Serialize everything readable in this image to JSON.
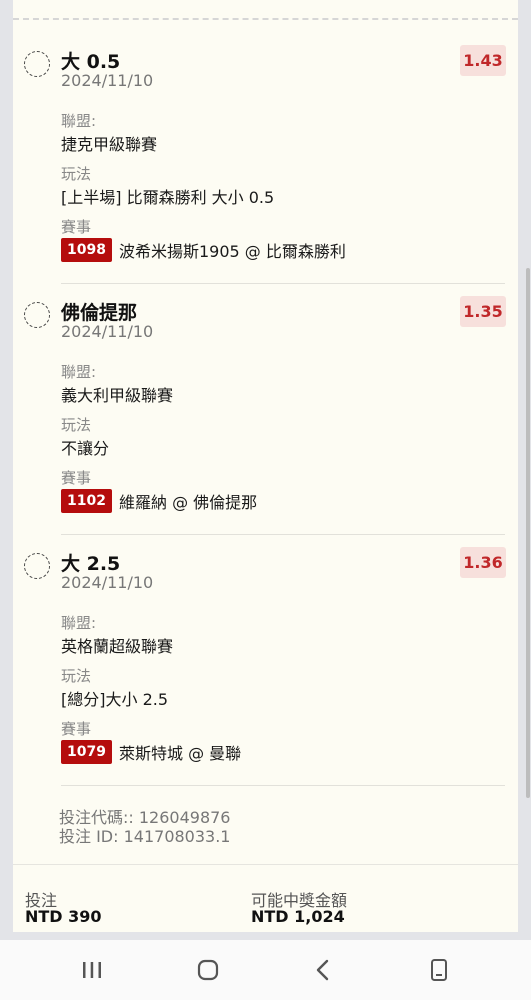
{
  "bets": [
    {
      "title": "大 0.5",
      "date": "2024/11/10",
      "odds": "1.43",
      "league_label": "聯盟:",
      "league": "捷克甲級聯賽",
      "market_label": "玩法",
      "market": "[上半場] 比爾森勝利 大小 0.5",
      "match_label": "賽事",
      "match_id": "1098",
      "match": "波希米揚斯1905 @ 比爾森勝利"
    },
    {
      "title": "佛倫提那",
      "date": "2024/11/10",
      "odds": "1.35",
      "league_label": "聯盟:",
      "league": "義大利甲級聯賽",
      "market_label": "玩法",
      "market": "不讓分",
      "match_label": "賽事",
      "match_id": "1102",
      "match": "維羅納 @ 佛倫提那"
    },
    {
      "title": "大 2.5",
      "date": "2024/11/10",
      "odds": "1.36",
      "league_label": "聯盟:",
      "league": "英格蘭超級聯賽",
      "market_label": "玩法",
      "market": "[總分]大小 2.5",
      "match_label": "賽事",
      "match_id": "1079",
      "match": "萊斯特城 @ 曼聯"
    }
  ],
  "reference": {
    "code": "投注代碼:: 126049876",
    "id": "投注 ID: 141708033.1"
  },
  "footer": {
    "stake_label": "投注",
    "stake_value": "NTD 390",
    "payout_label": "可能中獎金額",
    "payout_value": "NTD 1,024"
  },
  "colors": {
    "card_bg": "#fdfcf3",
    "odds_bg": "#f7e0dc",
    "odds_text": "#c0282a",
    "match_badge": "#b50d0d"
  },
  "navbar": {
    "icons": [
      "recent-apps-icon",
      "home-icon",
      "back-icon",
      "rotate-icon"
    ]
  }
}
